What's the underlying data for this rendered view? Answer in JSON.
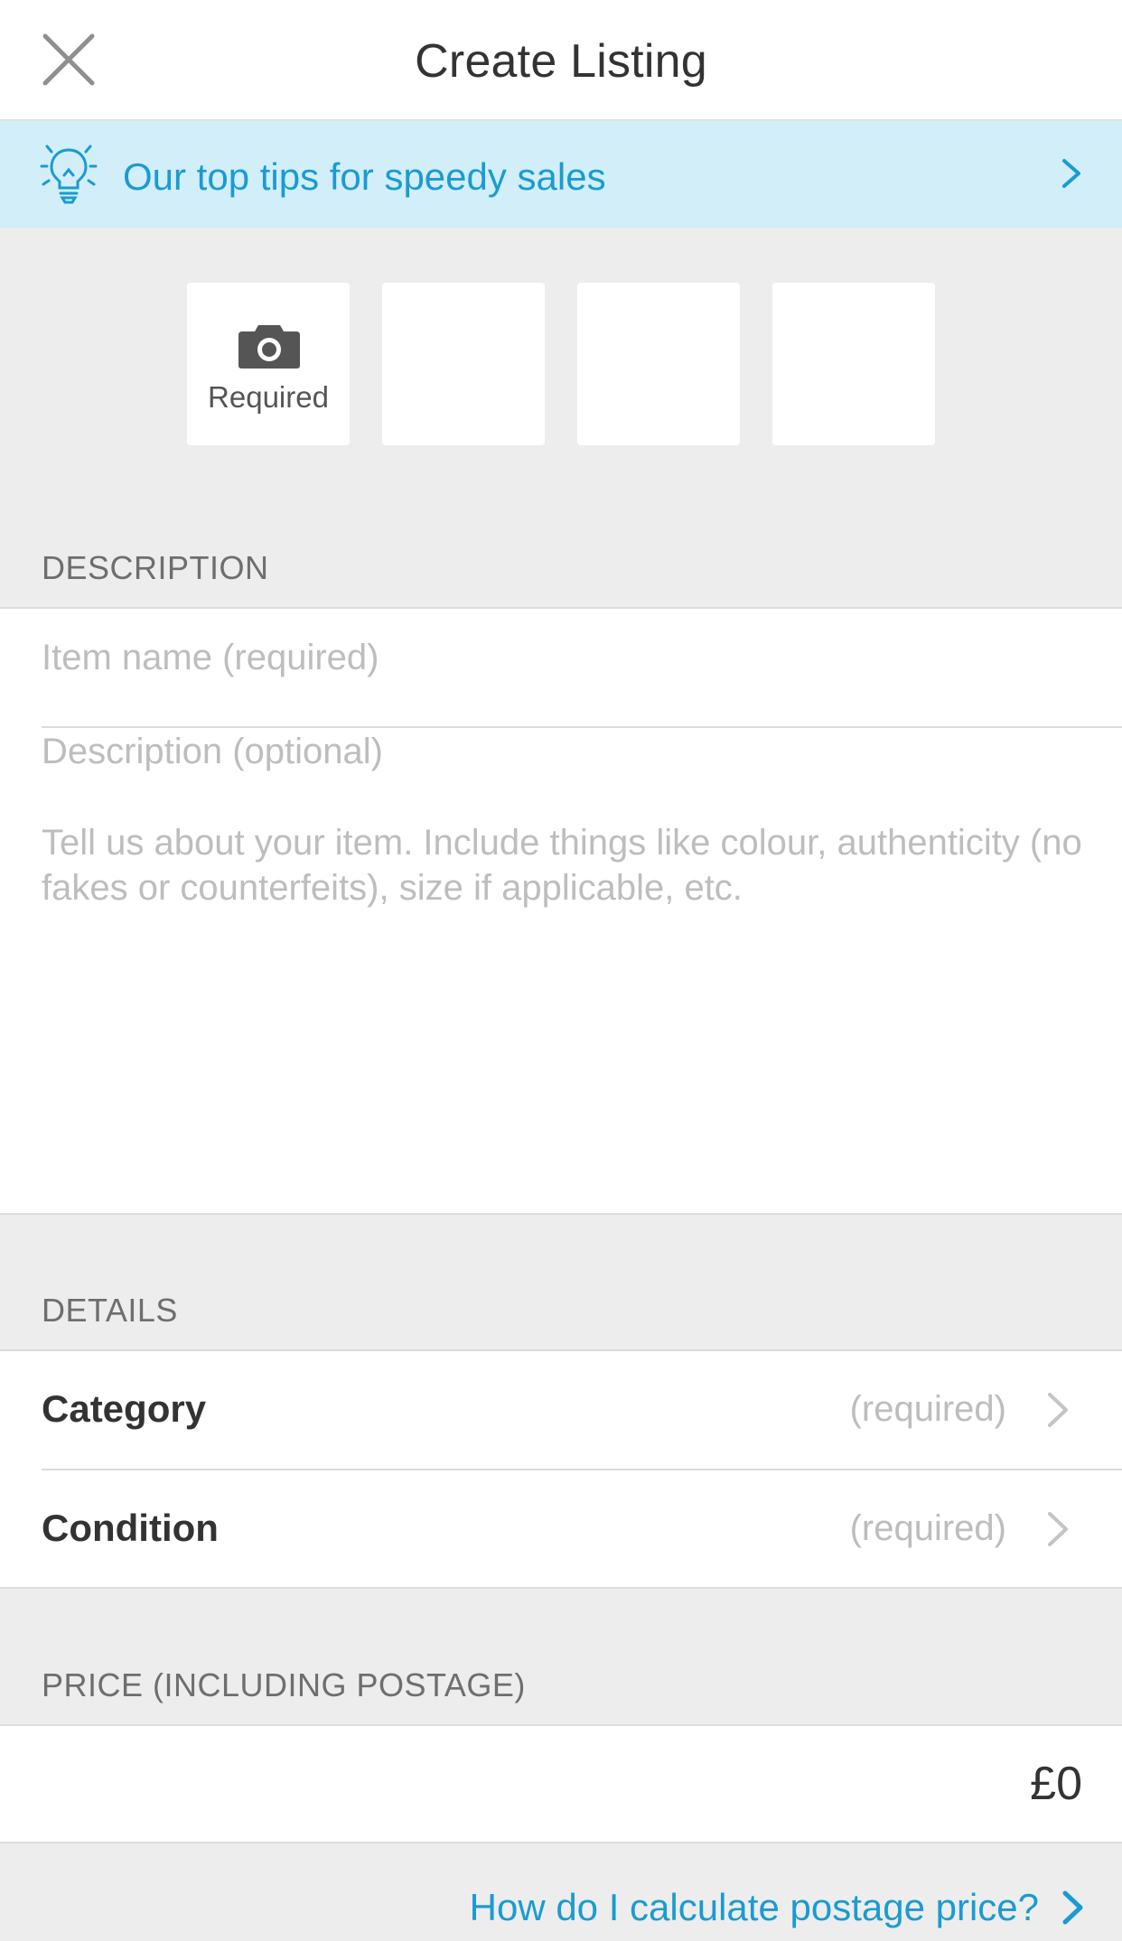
{
  "header": {
    "title": "Create Listing",
    "close_icon": "close-icon"
  },
  "tips_banner": {
    "label": "Our top tips for speedy sales",
    "icon": "lightbulb-icon",
    "chevron": "chevron-right-icon",
    "background": "#d2eef9",
    "text_color": "#1a9bd1"
  },
  "photos": {
    "slot_count": 4,
    "required_label": "Required",
    "icon": "camera-icon"
  },
  "description_section": {
    "heading": "DESCRIPTION",
    "item_name_placeholder": "Item name (required)",
    "description_placeholder": "Description (optional)",
    "description_hint": "Tell us about your item. Include things like colour, authenticity (no fakes or counterfeits), size if applicable, etc."
  },
  "details_section": {
    "heading": "DETAILS",
    "rows": [
      {
        "label": "Category",
        "value": "(required)"
      },
      {
        "label": "Condition",
        "value": "(required)"
      }
    ]
  },
  "price_section": {
    "heading": "PRICE (INCLUDING POSTAGE)",
    "value": "£0"
  },
  "postage_link": {
    "label": "How do I calculate postage price?"
  }
}
